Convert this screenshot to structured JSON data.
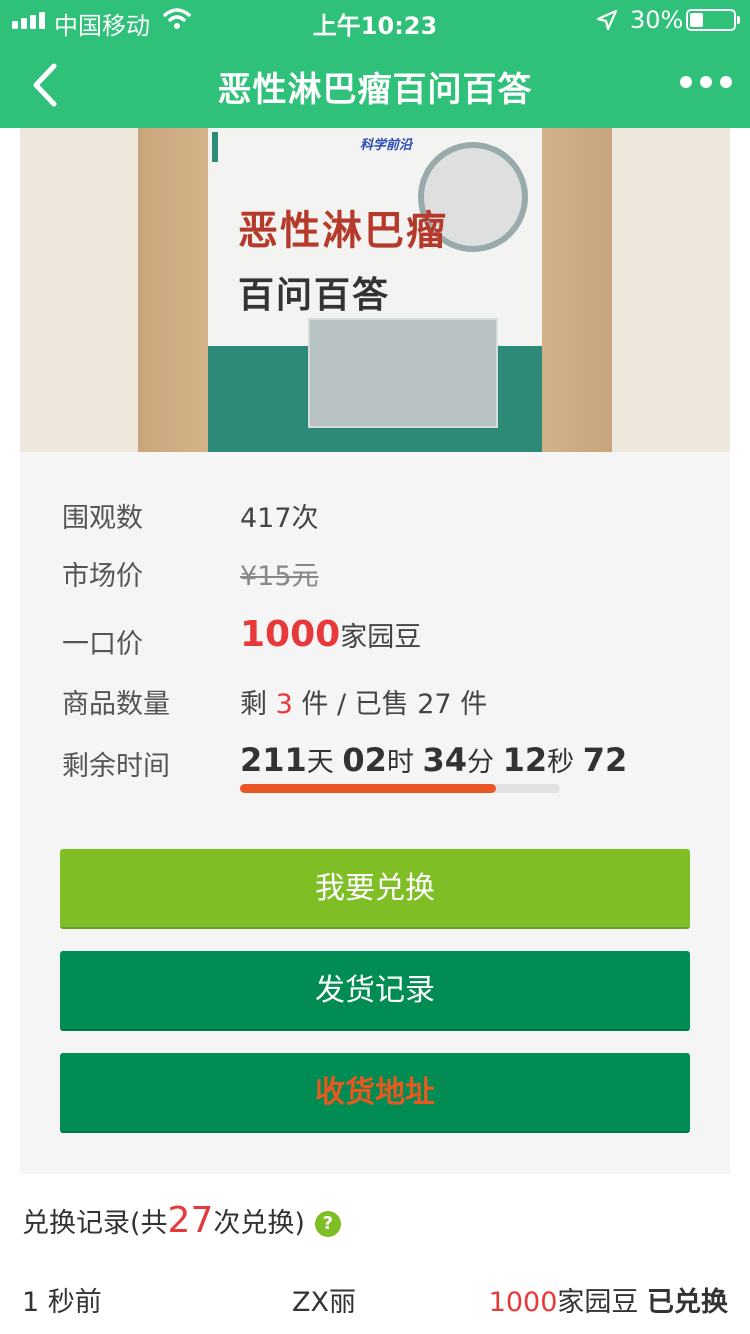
{
  "status_bar": {
    "carrier": "中国移动",
    "time": "上午10:23",
    "battery": "30%"
  },
  "nav": {
    "title": "恶性淋巴瘤百问百答"
  },
  "product_image": {
    "cover_title_line1": "恶性淋巴瘤",
    "cover_title_line2": "百问百答",
    "cover_tag": "科学前沿"
  },
  "info": {
    "views_label": "围观数",
    "views_value": "417次",
    "market_label": "市场价",
    "market_value": "¥15元",
    "price_label": "一口价",
    "price_number": "1000",
    "price_unit": "家园豆",
    "qty_label": "商品数量",
    "qty_prefix": "剩",
    "qty_remaining": "3",
    "qty_middle": "件 / 已售",
    "qty_sold": "27",
    "qty_suffix": "件",
    "time_label": "剩余时间",
    "timer": {
      "days": "211",
      "days_unit": "天",
      "hours": "02",
      "hours_unit": "时",
      "minutes": "34",
      "minutes_unit": "分",
      "seconds": "12",
      "seconds_unit": "秒",
      "ms": "72"
    },
    "progress_fraction": 0.8
  },
  "buttons": {
    "exchange": "我要兑换",
    "records": "发货记录",
    "address": "收货地址"
  },
  "records": {
    "title_prefix": "兑换记录(共",
    "count": "27",
    "title_suffix": "次兑换)",
    "help_glyph": "?",
    "items": [
      {
        "time": "1 秒前",
        "user": "ZX丽",
        "amount": "1000",
        "unit": "家园豆",
        "status": "已兑换"
      }
    ]
  },
  "colors": {
    "nav_green": "#2fc17a",
    "button_lime": "#7fbe25",
    "button_green": "#008c53",
    "accent_red": "#e8393a",
    "address_orange": "#e8581f",
    "progress_orange": "#e95523"
  }
}
